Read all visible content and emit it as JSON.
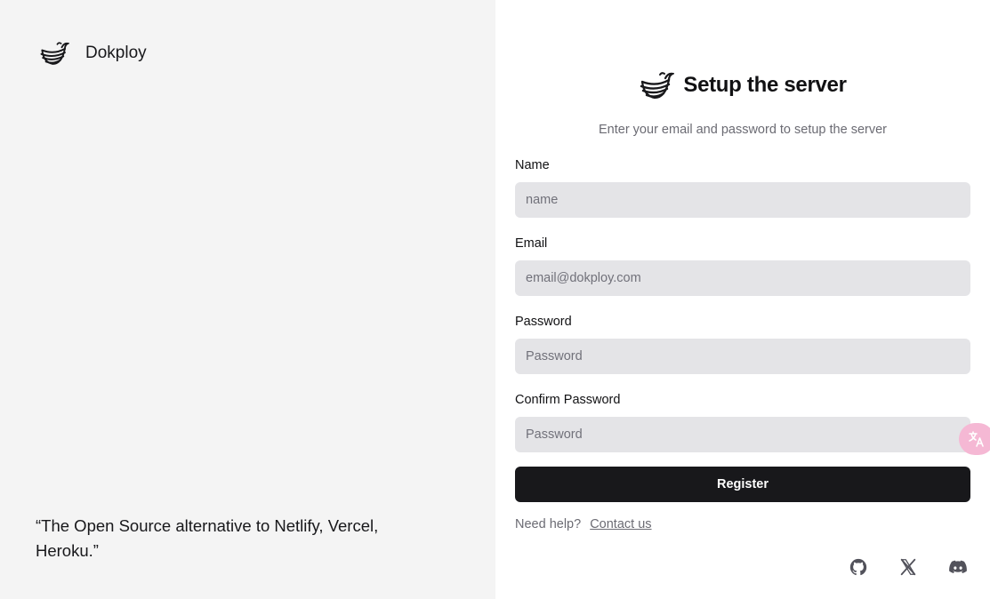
{
  "brand": {
    "name": "Dokploy",
    "icon": "dokploy-whale-logo-icon"
  },
  "quote": "“The Open Source alternative to Netlify, Vercel, Heroku.”",
  "form": {
    "title": "Setup the server",
    "subtitle": "Enter your email and password to setup the server",
    "fields": {
      "name": {
        "label": "Name",
        "placeholder": "name",
        "value": ""
      },
      "email": {
        "label": "Email",
        "placeholder": "email@dokploy.com",
        "value": ""
      },
      "password": {
        "label": "Password",
        "placeholder": "Password",
        "value": ""
      },
      "confirm_password": {
        "label": "Confirm Password",
        "placeholder": "Password",
        "value": ""
      }
    },
    "submit_label": "Register",
    "help_text": "Need help?",
    "help_link": "Contact us"
  },
  "social_links": [
    {
      "icon": "github-icon"
    },
    {
      "icon": "x-twitter-icon"
    },
    {
      "icon": "discord-icon"
    }
  ],
  "translate_widget": {
    "icon": "translate-icon"
  },
  "colors": {
    "left_panel_bg": "#f4f4f4",
    "input_bg": "#e4e4e7",
    "primary_button_bg": "#18181b",
    "muted_text": "#6b6b73",
    "translate_fab_bg": "#f5b8d4"
  }
}
